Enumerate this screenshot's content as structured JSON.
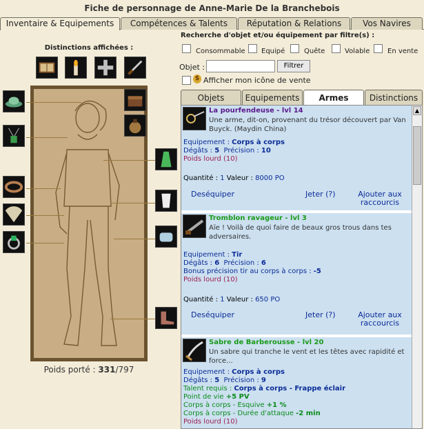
{
  "header": {
    "title": "Fiche de personnage de Anne-Marie De la Branchebois"
  },
  "tabs": [
    "Inventaire & Equipements",
    "Compétences & Talents",
    "Réputation & Relations",
    "Vos Navires"
  ],
  "left": {
    "distinctions_label": "Distinctions affichées :",
    "weight_label": "Poids porté :",
    "weight_value": "331",
    "weight_max": "/797"
  },
  "filters": {
    "title": "Recherche d'objet et/ou équipement par filtre(s) :",
    "options": [
      "Consommable",
      "Equipé",
      "Quête",
      "Volable",
      "En vente"
    ],
    "objet_label": "Objet :",
    "objet_value": "",
    "filter_btn": "Filtrer",
    "show_sale_icon": "Afficher mon icône de vente"
  },
  "subtabs": [
    "Objets",
    "Equipements",
    "Armes",
    "Distinctions"
  ],
  "items": [
    {
      "name": "La pourfendeuse - lvl 14",
      "desc": "Une arme, dit-on, provenant du trésor découvert par Van Buyck. (Maydin China)",
      "equip_label": "Equipement :",
      "equip": "Corps à corps",
      "degats_label": "Dégâts :",
      "degats": "5",
      "precision_label": "Précision :",
      "precision": "10",
      "poids": "Poids lourd (10)",
      "qty_label": "Quantité :",
      "qty": "1",
      "value_label": "Valeur :",
      "value": "8000 PO",
      "a1": "Deséquiper",
      "a2": "Jeter (?)",
      "a3": "Ajouter aux raccourcis"
    },
    {
      "name": "Tromblon ravageur - lvl 3",
      "desc": "Aïe ! Voilà de quoi faire de beaux gros trous dans tes adversaires.",
      "equip_label": "Equipement :",
      "equip": "Tir",
      "degats_label": "Dégâts :",
      "degats": "6",
      "precision_label": "Précision :",
      "precision": "6",
      "bonus_label": "Bonus précision tir au corps à corps :",
      "bonus": "-5",
      "poids": "Poids lourd (10)",
      "qty_label": "Quantité :",
      "qty": "1",
      "value_label": "Valeur :",
      "value": "650 PO",
      "a1": "Deséquiper",
      "a2": "Jeter (?)",
      "a3": "Ajouter aux raccourcis"
    },
    {
      "name": "Sabre de Barberousse - lvl 20",
      "desc": "Un sabre qui tranche le vent et les têtes avec rapidité et force...",
      "equip_label": "Equipement :",
      "equip": "Corps à corps",
      "degats_label": "Dégâts :",
      "degats": "5",
      "precision_label": "Précision :",
      "precision": "9",
      "talent_label": "Talent requis :",
      "talent": "Corps à corps - Frappe éclair",
      "pv_label": "Point de vie",
      "pv": "+5 PV",
      "esq_label": "Corps à corps - Esquive",
      "esq": "+1 %",
      "dur_label": "Corps à corps - Durée d'attaque",
      "dur": "-2 min",
      "poids": "Poids lourd (10)"
    }
  ],
  "colors": {
    "background": "#f3ecd8",
    "item_bg": "#cce0f0",
    "item_name": "#5a1a8a",
    "item_name_green": "#1a9a1a",
    "link": "#0b2b96"
  }
}
